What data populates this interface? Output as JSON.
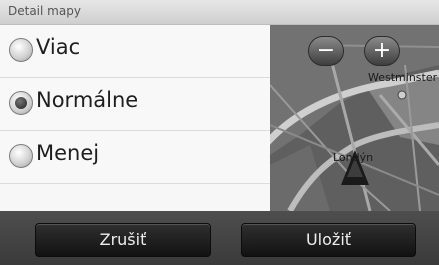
{
  "dialog": {
    "title": "Detail mapy"
  },
  "options": [
    {
      "label": "Viac",
      "selected": false
    },
    {
      "label": "Normálne",
      "selected": true
    },
    {
      "label": "Menej",
      "selected": false
    }
  ],
  "map": {
    "zoom_out": "−",
    "zoom_in": "+",
    "labels": {
      "westminster": "Westminster",
      "london": "Londýn"
    }
  },
  "buttons": {
    "cancel": "Zrušiť",
    "save": "Uložiť"
  }
}
